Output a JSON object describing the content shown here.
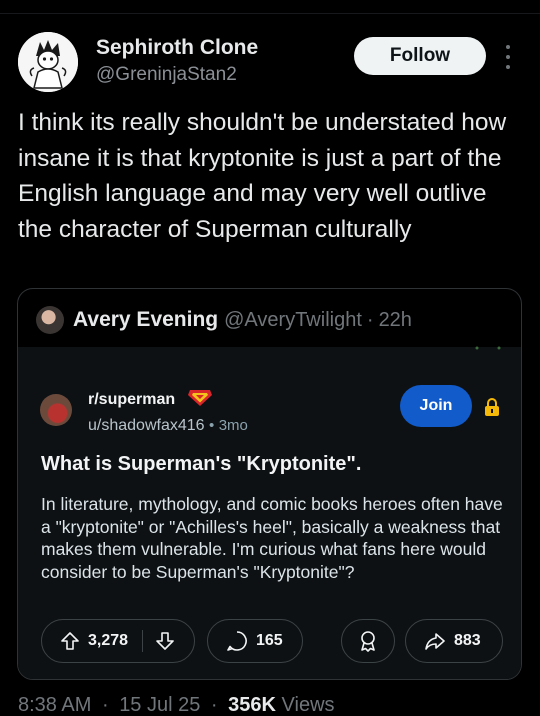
{
  "author": {
    "display_name": "Sephiroth Clone",
    "handle": "@GreninjaStan2",
    "avatar_icon": "anime-character-avatar"
  },
  "follow_label": "Follow",
  "tweet_text": "I think its really shouldn't be understated how insane it is that kryptonite is just a part of the English language and may very well outlive the character of Superman culturally",
  "quote": {
    "name": "Avery Evening",
    "handle": "@AveryTwilight",
    "separator": "·",
    "time": "22h"
  },
  "reddit": {
    "subreddit": "r/superman",
    "user": "u/shadowfax416",
    "separator": "•",
    "age": "3mo",
    "join_label": "Join",
    "title": "What is Superman's \"Kryptonite\".",
    "body": "In literature, mythology, and comic books heroes often have a \"kryptonite\" or \"Achilles's heel\", basically a weakness that makes them vulnerable. I'm curious what fans here would consider to be Superman's \"Kryptonite\"?",
    "upvotes": "3,278",
    "comments": "165",
    "shares": "883",
    "accent_blue": "#115bca",
    "lock_color": "#f5b90a"
  },
  "meta": {
    "time": "8:38 AM",
    "separator": "·",
    "date": "15 Jul 25",
    "views_count": "356K",
    "views_label": "Views"
  }
}
